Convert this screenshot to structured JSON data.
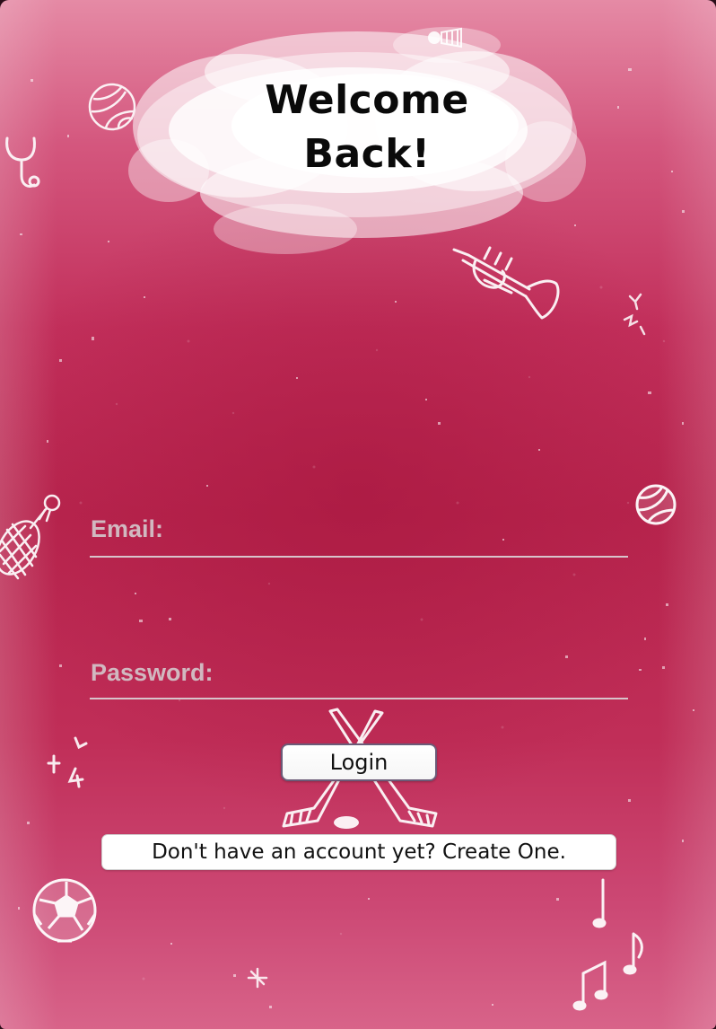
{
  "header": {
    "title_line1": "Welcome",
    "title_line2": "Back!"
  },
  "form": {
    "email_label": "Email:",
    "email_value": "",
    "password_label": "Password:",
    "password_value": ""
  },
  "actions": {
    "login_label": "Login",
    "create_account_label": "Don't have an account yet? Create One."
  },
  "decorations": [
    "volleyball-icon",
    "shuttlecock-icon",
    "stethoscope-icon",
    "trumpet-icon",
    "badminton-racket-icon",
    "hockey-sticks-icon",
    "soccer-ball-icon",
    "music-notes-icon",
    "sparkle-icon"
  ],
  "colors": {
    "background_top": "#e58aa5",
    "background_mid": "#b8254e",
    "background_bottom": "#d86389",
    "label": "#d1b8c0",
    "title": "#0a0a0a"
  }
}
